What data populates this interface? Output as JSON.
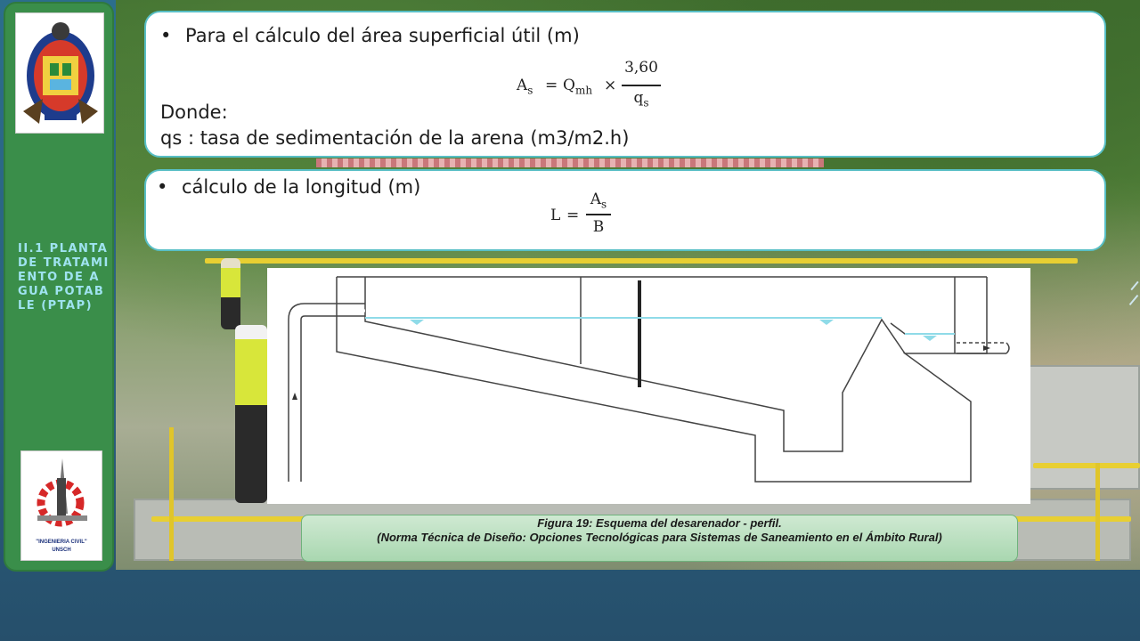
{
  "sidebar": {
    "section_label": "II.1 PLANTA DE TRATAMIENTO DE AGUA POTABLE (PTAP)",
    "logo_bottom_caption": "\"INGENIERIA CIVIL\"",
    "logo_bottom_subcaption": "UNSCH"
  },
  "card1": {
    "bullet": "Para el cálculo del área superficial útil (m)",
    "formula": {
      "lhs": "A",
      "lhs_sub": "s",
      "eq": "=",
      "q": "Q",
      "q_sub": "mh",
      "times": "×",
      "numerator": "3,60",
      "denominator": "q",
      "denominator_sub": "s"
    },
    "donde": "Donde:",
    "qs_def": "qs : tasa de sedimentación de la arena (m3/m2.h)"
  },
  "card2": {
    "bullet": "cálculo de la longitud (m)",
    "formula": {
      "lhs": "L",
      "eq": "=",
      "numerator": "A",
      "numerator_sub": "s",
      "denominator": "B"
    }
  },
  "caption": {
    "line1": "Figura 19: Esquema del desarenador - perfil.",
    "line2": "(Norma Técnica de Diseño: Opciones Tecnológicas para Sistemas de Saneamiento en el Ámbito Rural)"
  },
  "colors": {
    "sidebar": "#3a8e4a",
    "card_border": "#58bfc6",
    "section_label": "#9fe3f0",
    "water": "#8fdbe8"
  }
}
